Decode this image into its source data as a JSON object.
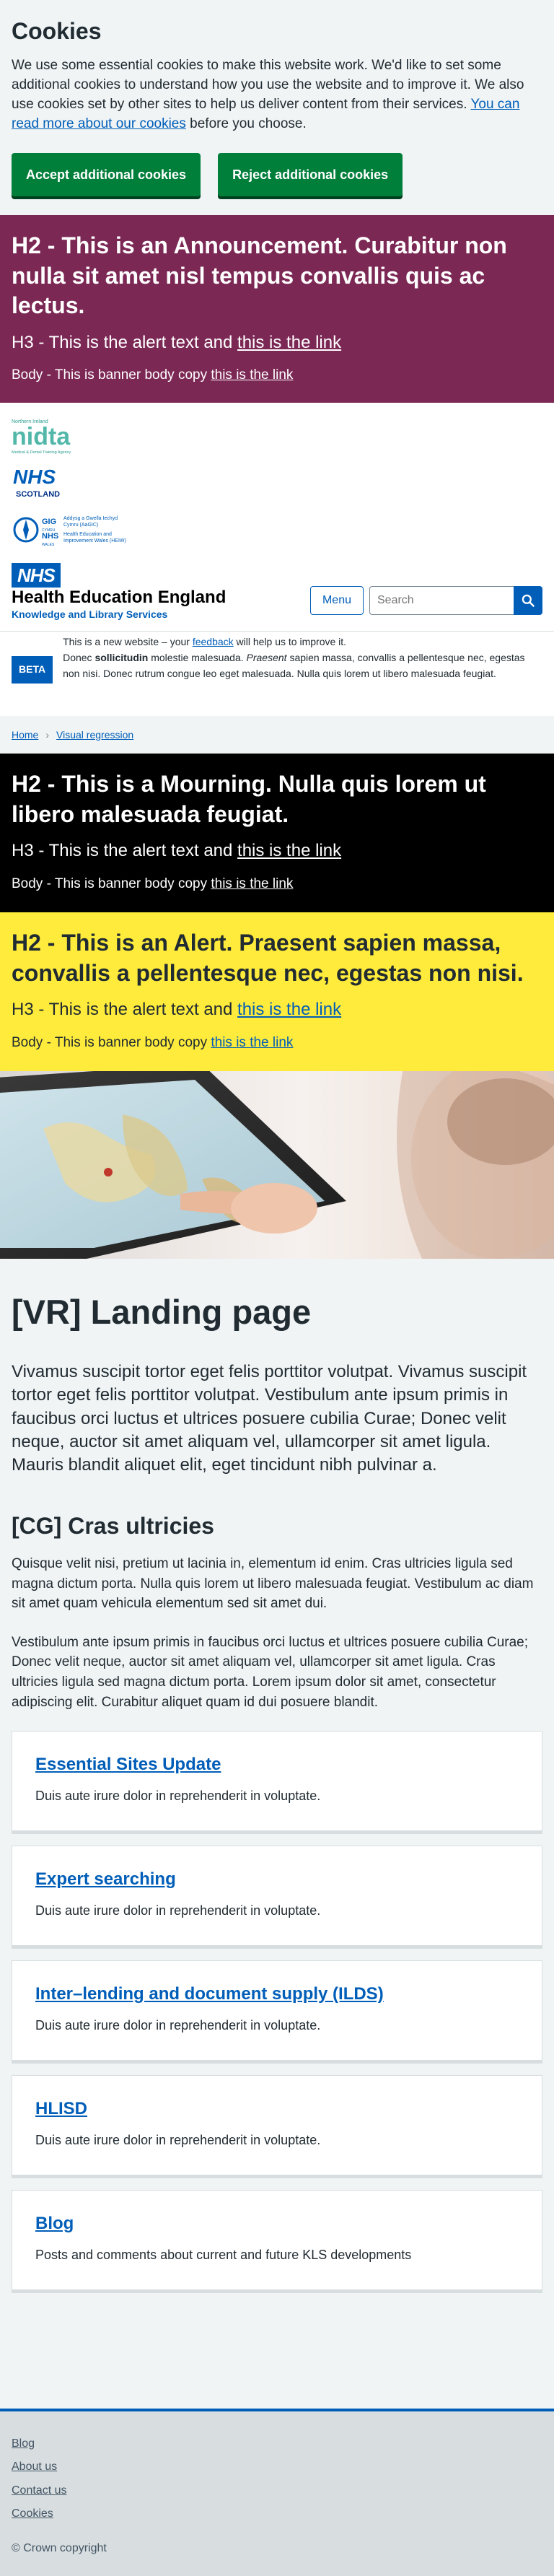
{
  "cookie": {
    "title": "Cookies",
    "text": "We use some essential cookies to make this website work. We'd like to set some additional cookies to understand how you use the website and to improve it. We also use cookies set by other sites to help us deliver content from their services.",
    "link": "You can read more about our cookies",
    "text_after": " before you choose.",
    "accept": "Accept additional cookies",
    "reject": "Reject additional cookies"
  },
  "announcement": {
    "h2": "H2 - This is an Announcement. Curabitur non nulla sit amet nisl tempus convallis quis ac lectus.",
    "h3": "H3 - This is the alert text and ",
    "h3_link": "this is the link",
    "body": "Body - This is banner body copy ",
    "body_link": "this is the link"
  },
  "logos": {
    "mdta_line1": "Northern Ireland",
    "mdta_word": "nidta",
    "mdta_line2": "Medical & Dental Training Agency",
    "nhs_scotland_nhs": "NHS",
    "nhs_scotland": "SCOTLAND",
    "hiew_gig": "GIG",
    "hiew_nhs": "NHS",
    "hiew_cymru": "CYMRU",
    "hiew_wales": "WALES",
    "hiew_text1": "Addysg a Gwella Iechyd",
    "hiew_text2": "Cymru (AaGIC)",
    "hiew_text3": "Health Education and",
    "hiew_text4": "Improvement Wales (HEIW)"
  },
  "header": {
    "nhs": "NHS",
    "org": "Health Education England",
    "strap": "Knowledge and Library Services",
    "menu": "Menu",
    "search_placeholder": "Search"
  },
  "phase": {
    "tag": "BETA",
    "line1_a": "This is a new website – your ",
    "line1_link": "feedback",
    "line1_b": " will help us to improve it.",
    "line2_a": "Donec ",
    "line2_bold": "sollicitudin",
    "line2_b": " molestie malesuada. ",
    "line2_italic": "Praesent",
    "line2_c": " sapien massa, convallis a pellentesque nec, egestas non nisi. Donec rutrum congue leo eget malesuada. Nulla quis lorem ut libero malesuada feugiat."
  },
  "breadcrumb": {
    "home": "Home",
    "current": "Visual regression"
  },
  "mourning": {
    "h2": "H2 - This is a Mourning. Nulla quis lorem ut libero malesuada feugiat.",
    "h3": "H3 - This is the alert text and ",
    "h3_link": "this is the link",
    "body": "Body - This is banner body copy ",
    "body_link": "this is the link"
  },
  "alert": {
    "h2": "H2 - This is an Alert. Praesent sapien massa, convallis a pellentesque nec, egestas non nisi.",
    "h3": "H3 - This is the alert text and ",
    "h3_link": "this is the link",
    "body": "Body - This is banner body copy ",
    "body_link": "this is the link"
  },
  "main": {
    "title": "[VR] Landing page",
    "lede": "Vivamus suscipit tortor eget felis porttitor volutpat. Vivamus suscipit tortor eget felis porttitor volutpat. Vestibulum ante ipsum primis in faucibus orci luctus et ultrices posuere cubilia Curae; Donec velit neque, auctor sit amet aliquam vel, ullamcorper sit amet ligula. Mauris blandit aliquet elit, eget tincidunt nibh pulvinar a.",
    "cg_title": "[CG] Cras ultricies",
    "para1": "Quisque velit nisi, pretium ut lacinia in, elementum id enim. Cras ultricies ligula sed magna dictum porta. Nulla quis lorem ut libero malesuada feugiat. Vestibulum ac diam sit amet quam vehicula elementum sed sit amet dui.",
    "para2": "Vestibulum ante ipsum primis in faucibus orci luctus et ultrices posuere cubilia Curae; Donec velit neque, auctor sit amet aliquam vel, ullamcorper sit amet ligula. Cras ultricies ligula sed magna dictum porta. Lorem ipsum dolor sit amet, consectetur adipiscing elit. Curabitur aliquet quam id dui posuere blandit.",
    "cards": [
      {
        "title": "Essential Sites Update",
        "text": "Duis aute irure dolor in reprehenderit in voluptate."
      },
      {
        "title": "Expert searching",
        "text": "Duis aute irure dolor in reprehenderit in voluptate."
      },
      {
        "title": "Inter–lending and document supply (ILDS)",
        "text": "Duis aute irure dolor in reprehenderit in voluptate."
      },
      {
        "title": "HLISD",
        "text": "Duis aute irure dolor in reprehenderit in voluptate."
      },
      {
        "title": "Blog",
        "text": "Posts and comments about current and future KLS developments"
      }
    ]
  },
  "footer": {
    "links": [
      "Blog",
      "About us",
      "Contact us",
      "Cookies"
    ],
    "copyright": "© Crown copyright"
  },
  "colors": {
    "nhs_blue": "#005eb8",
    "announcement": "#7c2855",
    "alert": "#ffeb3b",
    "green_button": "#007f3b"
  }
}
